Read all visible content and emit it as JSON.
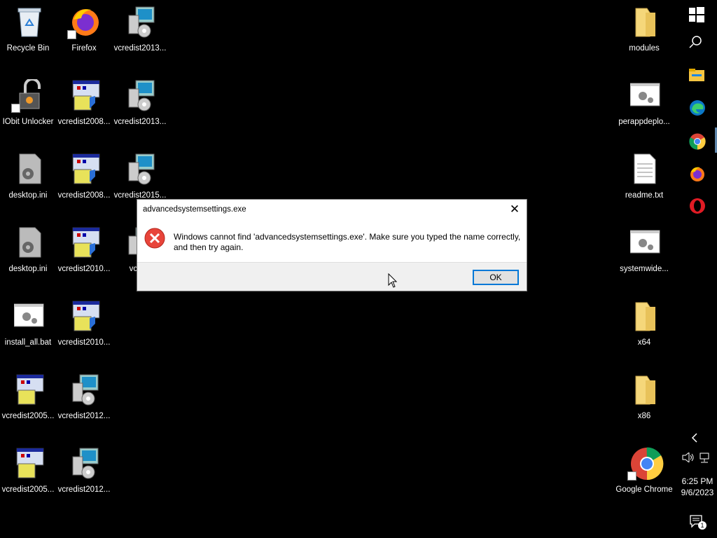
{
  "desktop": {
    "icons_left": [
      {
        "label": "Recycle Bin",
        "icon": "recycle-bin-icon"
      },
      {
        "label": "Firefox",
        "icon": "firefox-icon"
      },
      {
        "label": "vcredist2013...",
        "icon": "installer-icon"
      },
      {
        "label": "IObit Unlocker",
        "icon": "iobit-unlocker-icon"
      },
      {
        "label": "vcredist2008...",
        "icon": "setup-icon"
      },
      {
        "label": "vcredist2013...",
        "icon": "installer-icon"
      },
      {
        "label": "desktop.ini",
        "icon": "settings-file-icon"
      },
      {
        "label": "vcredist2008...",
        "icon": "setup-icon"
      },
      {
        "label": "vcredist2015...",
        "icon": "installer-icon"
      },
      {
        "label": "desktop.ini",
        "icon": "settings-file-icon"
      },
      {
        "label": "vcredist2010...",
        "icon": "setup-icon"
      },
      {
        "label": "vcredi",
        "icon": "installer-icon"
      },
      {
        "label": "install_all.bat",
        "icon": "batch-file-icon"
      },
      {
        "label": "vcredist2010...",
        "icon": "setup-icon"
      },
      {
        "label": "vcredist2005...",
        "icon": "setup-icon"
      },
      {
        "label": "vcredist2012...",
        "icon": "installer-icon"
      },
      {
        "label": "vcredist2005...",
        "icon": "setup-icon"
      },
      {
        "label": "vcredist2012...",
        "icon": "installer-icon"
      }
    ],
    "icons_right": [
      {
        "label": "modules",
        "icon": "folder-icon"
      },
      {
        "label": "perappdeplo...",
        "icon": "batch-file-icon"
      },
      {
        "label": "readme.txt",
        "icon": "text-file-icon"
      },
      {
        "label": "systemwide...",
        "icon": "batch-file-icon"
      },
      {
        "label": "x64",
        "icon": "folder-icon"
      },
      {
        "label": "x86",
        "icon": "folder-icon"
      },
      {
        "label": "Google Chrome",
        "icon": "chrome-icon"
      }
    ]
  },
  "dialog": {
    "title": "advancedsystemsettings.exe",
    "message": "Windows cannot find 'advancedsystemsettings.exe'. Make sure you typed the name correctly, and then try again.",
    "ok_label": "OK",
    "close_glyph": "✕"
  },
  "taskbar": {
    "time": "6:25 PM",
    "date": "9/6/2023",
    "notification_count": "1",
    "apps": [
      "start",
      "search",
      "file-explorer",
      "edge",
      "chrome",
      "firefox",
      "opera"
    ]
  }
}
